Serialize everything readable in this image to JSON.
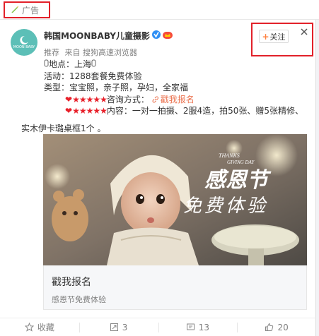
{
  "ad": {
    "label": "广告"
  },
  "user": {
    "avatar_text": "MOON BABY",
    "name": "韩国MOONBABY儿童摄影",
    "meta_recommend": "推荐",
    "meta_source": "来自 搜狗高速浏览器"
  },
  "actions": {
    "follow_label": "关注"
  },
  "post": {
    "line1": "地点：上海",
    "line2": "活动：1288套餐免费体验",
    "line3": "类型：宝宝照，亲子照，孕妇，全家福",
    "line4_stars": "★★★★★",
    "line4_label": "咨询方式：",
    "line4_link": "戳我报名",
    "line5_stars": "★★★★★",
    "line5_text": "内容：一对一拍摄、2服4造，拍50张、赠5张精修、",
    "line6": "实木伊卡璐桌框1个 。"
  },
  "media": {
    "overlay_small1": "THANKS",
    "overlay_small2": "GIVING DAY",
    "overlay_title": "感恩节",
    "overlay_sub": "免费体验"
  },
  "link_card": {
    "title": "戳我报名",
    "subtitle": "感恩节免费体验"
  },
  "footer": {
    "favorite": "收藏",
    "repost": "3",
    "comment": "13",
    "like": "20"
  },
  "colors": {
    "highlight": "#e2212a",
    "link": "#eb7350",
    "verified": "#2f8ff4"
  }
}
